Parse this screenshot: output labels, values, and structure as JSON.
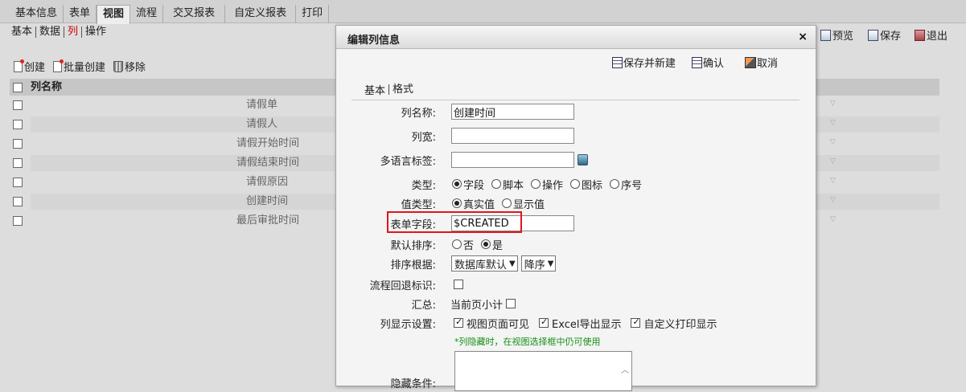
{
  "top_tabs": [
    "基本信息",
    "表单",
    "视图",
    "流程",
    "交叉报表",
    "自定义报表",
    "打印"
  ],
  "top_tabs_active": "视图",
  "subnav": [
    "基本",
    "数据",
    "列",
    "操作"
  ],
  "right_actions": {
    "preview": "预览",
    "save": "保存",
    "exit": "退出"
  },
  "toolbar": {
    "create": "创建",
    "batch_create": "批量创建",
    "remove": "移除"
  },
  "grid": {
    "header": "列名称",
    "rows": [
      "请假单",
      "请假人",
      "请假开始时间",
      "请假结束时间",
      "请假原因",
      "创建时间",
      "最后审批时间"
    ]
  },
  "dialog": {
    "title": "编辑列信息",
    "close": "×",
    "actions": {
      "save_new": "保存并新建",
      "confirm": "确认",
      "cancel": "取消"
    },
    "tabs": [
      "基本",
      "格式"
    ],
    "form": {
      "col_name_label": "列名称:",
      "col_name_value": "创建时间",
      "col_width_label": "列宽:",
      "col_width_value": "",
      "i18n_label": "多语言标签:",
      "i18n_value": "",
      "type_label": "类型:",
      "type_options": [
        "字段",
        "脚本",
        "操作",
        "图标",
        "序号"
      ],
      "type_selected": "字段",
      "value_type_label": "值类型:",
      "value_type_options": [
        "真实值",
        "显示值"
      ],
      "value_type_selected": "真实值",
      "form_field_label": "表单字段:",
      "form_field_value": "$CREATED",
      "default_sort_label": "默认排序:",
      "default_sort_options": [
        "否",
        "是"
      ],
      "default_sort_selected": "是",
      "sort_basis_label": "排序根据:",
      "sort_basis_value": "数据库默认",
      "sort_order_value": "降序",
      "flow_back_label": "流程回退标识:",
      "summary_label": "汇总:",
      "summary_page_subtotal": "当前页小计",
      "display_label": "列显示设置:",
      "display_options": [
        "视图页面可见",
        "Excel导出显示",
        "自定义打印显示"
      ],
      "hidden_note": "*列隐藏时，在视图选择框中仍可使用",
      "hide_condition_label": "隐藏条件:"
    }
  },
  "colors": {
    "highlight": "#e0151d",
    "note": "#159015"
  }
}
